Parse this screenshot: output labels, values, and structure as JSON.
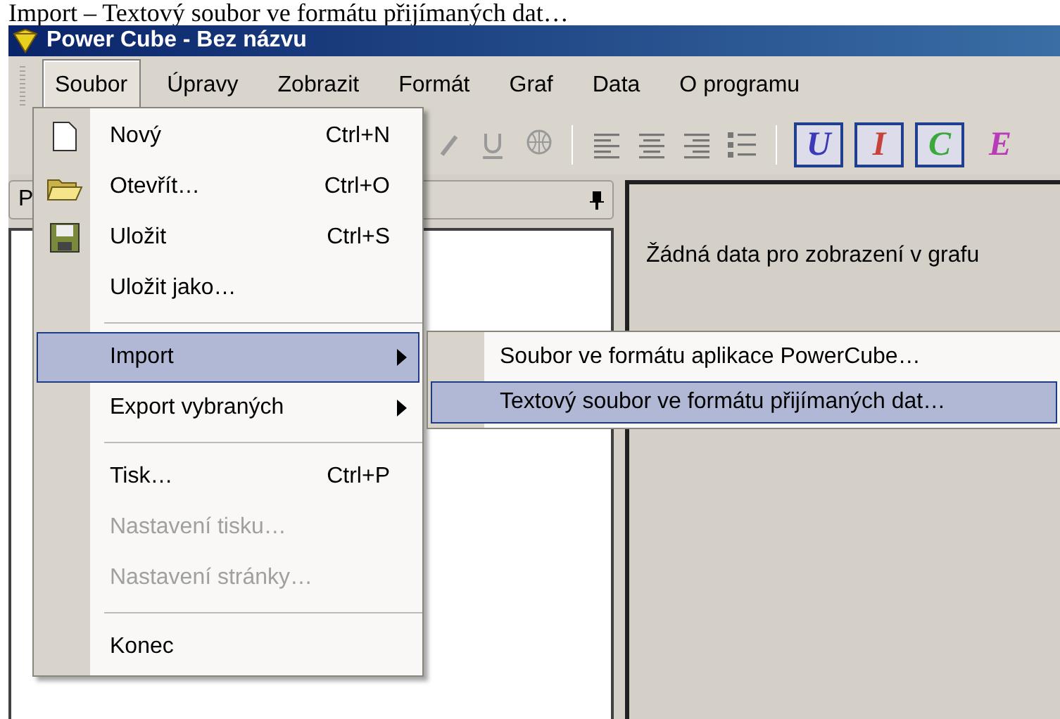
{
  "caption": "Import – Textový soubor ve formátu přijímaných dat…",
  "window": {
    "title": "Power Cube - Bez názvu"
  },
  "menu_bar": [
    {
      "label": "Soubor",
      "selected": true
    },
    {
      "label": "Úpravy",
      "selected": false
    },
    {
      "label": "Zobrazit",
      "selected": false
    },
    {
      "label": "Formát",
      "selected": false
    },
    {
      "label": "Graf",
      "selected": false
    },
    {
      "label": "Data",
      "selected": false
    },
    {
      "label": "O programu",
      "selected": false
    }
  ],
  "toolbar": {
    "letter_buttons": [
      {
        "label": "U",
        "color": "#3b3bb8",
        "checked": true
      },
      {
        "label": "I",
        "color": "#c8413a",
        "checked": true
      },
      {
        "label": "C",
        "color": "#3aa83a",
        "checked": true
      },
      {
        "label": "E",
        "color": "#b83cb8",
        "checked": false
      }
    ]
  },
  "left_panel": {
    "title": "P"
  },
  "chart_panel": {
    "message": "Žádná data pro zobrazení v grafu"
  },
  "file_menu": {
    "items": [
      {
        "kind": "item",
        "label": "Nový",
        "shortcut": "Ctrl+N",
        "selected": false,
        "disabled": false
      },
      {
        "kind": "item",
        "label": "Otevřít…",
        "shortcut": "Ctrl+O",
        "selected": false,
        "disabled": false
      },
      {
        "kind": "item",
        "label": "Uložit",
        "shortcut": "Ctrl+S",
        "selected": false,
        "disabled": false
      },
      {
        "kind": "item",
        "label": "Uložit jako…",
        "selected": false,
        "disabled": false
      },
      {
        "kind": "separator"
      },
      {
        "kind": "submenu",
        "label": "Import",
        "selected": true,
        "disabled": false
      },
      {
        "kind": "submenu",
        "label": "Export vybraných",
        "selected": false,
        "disabled": false
      },
      {
        "kind": "separator"
      },
      {
        "kind": "item",
        "label": "Tisk…",
        "shortcut": "Ctrl+P",
        "selected": false,
        "disabled": false
      },
      {
        "kind": "item",
        "label": "Nastavení tisku…",
        "selected": false,
        "disabled": true
      },
      {
        "kind": "item",
        "label": "Nastavení stránky…",
        "selected": false,
        "disabled": true
      },
      {
        "kind": "separator"
      },
      {
        "kind": "item",
        "label": "Konec",
        "selected": false,
        "disabled": false
      }
    ]
  },
  "import_submenu": {
    "items": [
      {
        "label": "Soubor ve formátu aplikace PowerCube…",
        "selected": false
      },
      {
        "label": "Textový soubor ve formátu přijímaných dat…",
        "selected": true
      }
    ]
  }
}
